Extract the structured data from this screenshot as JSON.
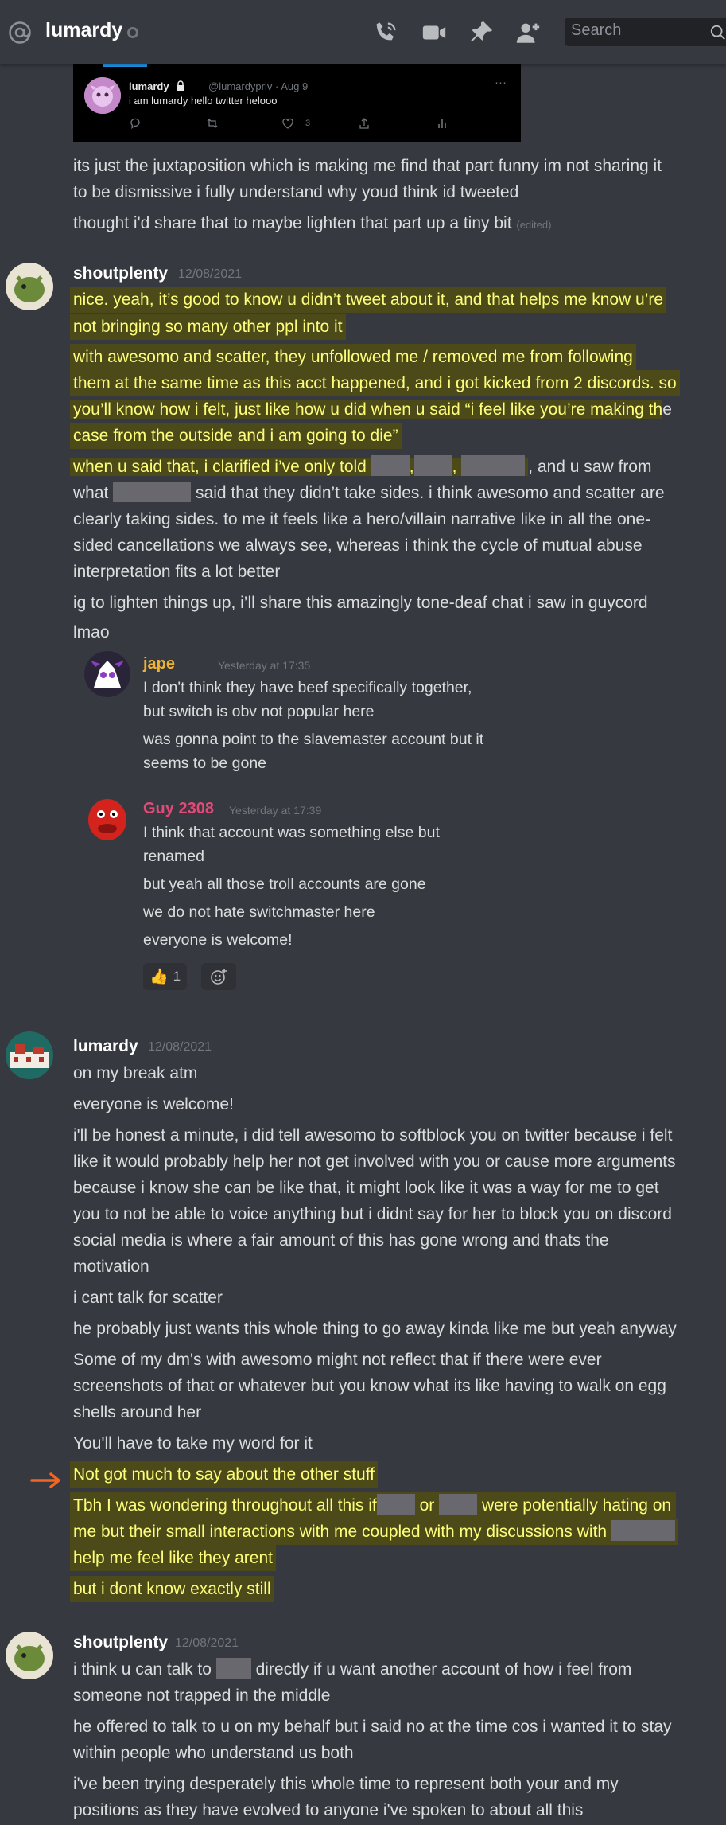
{
  "header": {
    "title": "lumardy",
    "search_placeholder": "Search",
    "icons": [
      "at-icon",
      "status-dot",
      "call-icon",
      "video-icon",
      "pin-icon",
      "add-friend-icon",
      "search-icon"
    ]
  },
  "embed": {
    "display_name": "lumardy",
    "handle_date": "@lumardypriv · Aug 9",
    "more": "···",
    "text": "i am lumardy hello twitter helooo",
    "likes": "3"
  },
  "top_messages": [
    "its just the juxtaposition which is making me find that part funny im not sharing it",
    "to be dismissive i fully understand why youd think id tweeted",
    "thought i'd share that to maybe lighten that part up a tiny bit",
    "(edited)"
  ],
  "msg1": {
    "username": "shoutplenty",
    "timestamp": "12/08/2021",
    "lines": [
      "nice. yeah, it’s good to know u didn’t tweet about it, and that helps me know u’re",
      "not bringing so many other ppl into it",
      "with awesomo and scatter, they unfollowed me / removed me from following",
      "them at the same time as this acct happened, and i got kicked from 2 discords. so",
      "you’ll know how i felt, just like how u did when u said “i feel like you’re making th",
      "e",
      "case from the outside and i am going to die”",
      "when u said that, i clarified i’ve only told",
      ",",
      ",",
      ", and",
      ", and u saw from",
      "what",
      "said that they didn’t take sides. i think awesomo and scatter are",
      "clearly taking sides. to me it feels like a hero/villain narrative like in all the one-",
      "sided cancellations we always see, whereas i think the cycle of mutual abuse",
      "interpretation fits a lot better",
      "ig to lighten things up, i’ll share this amazingly tone-deaf chat i saw in guycord",
      "lmao"
    ]
  },
  "quote": {
    "jape": {
      "username": "jape",
      "timestamp": "Yesterday at 17:35",
      "color": "#f0b232",
      "lines": [
        "I don't think they have beef specifically together,",
        "but switch is obv not popular here",
        "was gonna point to the slavemaster account but it",
        "seems to be gone"
      ]
    },
    "guy": {
      "username": "Guy 2308",
      "timestamp": "Yesterday at 17:39",
      "color": "#e24a78",
      "lines": [
        "I think that account was something else but",
        "renamed",
        "but yeah all those troll accounts are gone",
        "we do not hate switchmaster here",
        "everyone is welcome!"
      ],
      "reaction_count": "1"
    }
  },
  "msg2": {
    "username": "lumardy",
    "timestamp": "12/08/2021",
    "lines": [
      "on my break atm",
      "everyone is welcome!",
      "i'll be honest a minute, i did tell awesomo to softblock you on twitter because i felt",
      "like it would probably help her not get involved with you or cause more arguments",
      "because i know she can be like that, it might look like it was a way for me to get",
      "you to not be able to voice anything but i didnt say for her to block you on discord",
      "social media is where a fair amount of this has gone wrong and thats the",
      "motivation",
      "i cant talk for scatter",
      "he probably just wants this whole thing to go away kinda like me but yeah anyway",
      "Some of my dm's with awesomo might not reflect that if there were ever",
      "screenshots of that or whatever but you know what its like having to walk on egg",
      "shells around her",
      "You'll have to take my word for it",
      "Not got much to say about the other stuff",
      "Tbh I was wondering throughout all this if",
      "or",
      "were potentially hating on",
      "me but their small interactions with me coupled with my discussions with",
      "help me feel like they arent",
      "but i dont know exactly still"
    ]
  },
  "msg3": {
    "username": "shoutplenty",
    "timestamp": "12/08/2021",
    "lines": [
      "i think u can talk to",
      "directly if u want another account of how i feel from",
      "someone not trapped in the middle",
      "he offered to talk to u on my behalf but i said no at the time cos i wanted it to stay",
      "within people who understand us both",
      "i've been trying desperately this whole time to represent both your and my",
      "positions as they have evolved to anyone i've spoken to about all this"
    ]
  },
  "colors": {
    "background": "#36393f",
    "highlight_bg": "#4b4a18",
    "highlight_text": "#fdfd7a",
    "arrow": "#f26522"
  }
}
